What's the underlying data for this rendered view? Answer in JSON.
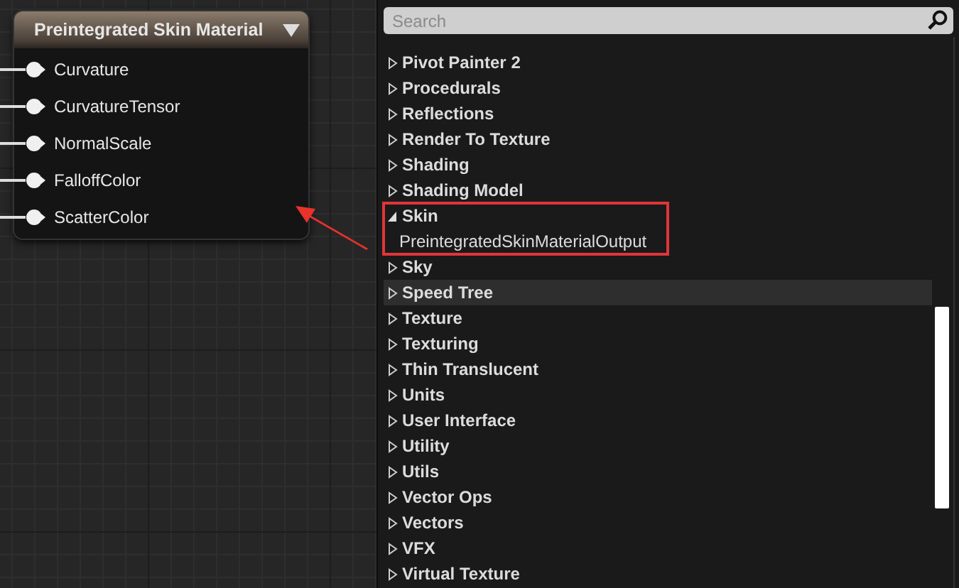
{
  "node": {
    "title": "Preintegrated Skin Material",
    "pins": [
      {
        "label": "Curvature",
        "connected": true
      },
      {
        "label": "CurvatureTensor",
        "connected": true
      },
      {
        "label": "NormalScale",
        "connected": true
      },
      {
        "label": "FalloffColor",
        "connected": true
      },
      {
        "label": "ScatterColor",
        "connected": true
      }
    ]
  },
  "palette": {
    "search": {
      "placeholder": "Search"
    },
    "items": [
      {
        "label": "Pivot Painter 2",
        "expanded": false,
        "selected": false,
        "highlighted": false
      },
      {
        "label": "Procedurals",
        "expanded": false,
        "selected": false,
        "highlighted": false
      },
      {
        "label": "Reflections",
        "expanded": false,
        "selected": false,
        "highlighted": false
      },
      {
        "label": "Render To Texture",
        "expanded": false,
        "selected": false,
        "highlighted": false
      },
      {
        "label": "Shading",
        "expanded": false,
        "selected": false,
        "highlighted": false
      },
      {
        "label": "Shading Model",
        "expanded": false,
        "selected": false,
        "highlighted": false
      },
      {
        "label": "Skin",
        "expanded": true,
        "selected": false,
        "highlighted": true,
        "children": [
          {
            "label": "PreintegratedSkinMaterialOutput",
            "selected": false
          }
        ]
      },
      {
        "label": "Sky",
        "expanded": false,
        "selected": false,
        "highlighted": false
      },
      {
        "label": "Speed Tree",
        "expanded": false,
        "selected": true,
        "highlighted": false
      },
      {
        "label": "Texture",
        "expanded": false,
        "selected": false,
        "highlighted": false
      },
      {
        "label": "Texturing",
        "expanded": false,
        "selected": false,
        "highlighted": false
      },
      {
        "label": "Thin Translucent",
        "expanded": false,
        "selected": false,
        "highlighted": false
      },
      {
        "label": "Units",
        "expanded": false,
        "selected": false,
        "highlighted": false
      },
      {
        "label": "User Interface",
        "expanded": false,
        "selected": false,
        "highlighted": false
      },
      {
        "label": "Utility",
        "expanded": false,
        "selected": false,
        "highlighted": false
      },
      {
        "label": "Utils",
        "expanded": false,
        "selected": false,
        "highlighted": false
      },
      {
        "label": "Vector Ops",
        "expanded": false,
        "selected": false,
        "highlighted": false
      },
      {
        "label": "Vectors",
        "expanded": false,
        "selected": false,
        "highlighted": false
      },
      {
        "label": "VFX",
        "expanded": false,
        "selected": false,
        "highlighted": false
      },
      {
        "label": "Virtual Texture",
        "expanded": false,
        "selected": false,
        "highlighted": false
      }
    ]
  }
}
